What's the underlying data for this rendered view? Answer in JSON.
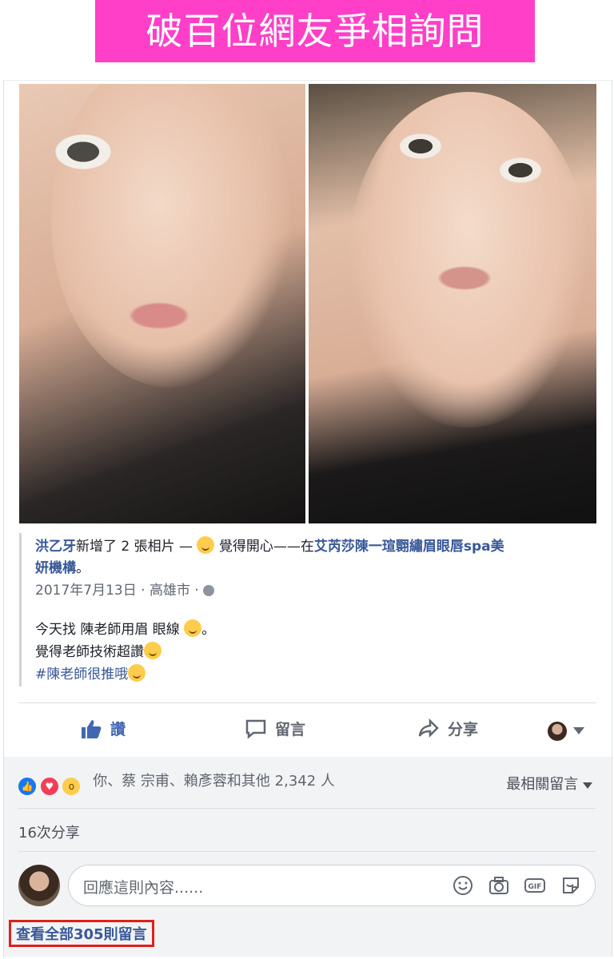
{
  "banner": {
    "text": "破百位網友爭相詢問"
  },
  "post": {
    "author": "洪乙牙",
    "added_text": "新增了 2 張相片 —",
    "feeling": "覺得開心——在",
    "place": "艾芮莎陳一瑄翾繡眉眼唇spa美",
    "place_cont": "妍機構",
    "place_end": "。",
    "date": "2017年7月13日",
    "city": "高雄市",
    "dot1": "·",
    "dot2": "·",
    "body_line1": "今天找 陳老師用眉 眼線",
    "body_line1_end": "。",
    "body_line2": "覺得老師技術超讚",
    "hashtag": "#陳老師很推哦"
  },
  "actions": {
    "like": "讚",
    "comment": "留言",
    "share": "分享"
  },
  "reactions": {
    "summary": "你、蔡 宗甫、賴彥蓉和其他 2,342 人",
    "sort_label": "最相關留言"
  },
  "shares_text": "16次分享",
  "comment_input": {
    "placeholder": "回應這則內容......"
  },
  "view_all": "查看全部305則留言",
  "colors": {
    "banner": "#ff3fc8",
    "link": "#385898",
    "highlight_box": "#e0201b"
  }
}
